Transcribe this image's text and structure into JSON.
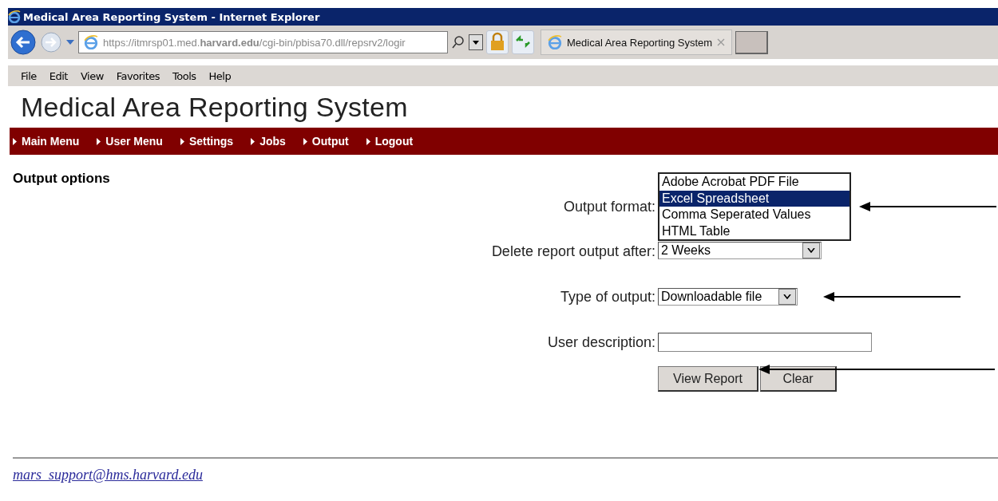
{
  "window": {
    "title": "Medical Area Reporting System - Internet Explorer"
  },
  "address_bar": {
    "url": "https://itmrsp01.med.**harvard.edu**/cgi-bin/pbisa70.dll/repsrv2/logir"
  },
  "tabs": [
    {
      "label": "Medical Area Reporting System",
      "selected": true
    }
  ],
  "menu": [
    "File",
    "Edit",
    "View",
    "Favorites",
    "Tools",
    "Help"
  ],
  "page_title": "Medical Area Reporting System",
  "nav": [
    "Main Menu",
    "User Menu",
    "Settings",
    "Jobs",
    "Output",
    "Logout"
  ],
  "section_title": "Output options",
  "fields": [
    {
      "kind": "listbox",
      "label": "Output format:",
      "options": [
        {
          "label": "Adobe Acrobat PDF File",
          "selected": false
        },
        {
          "label": "Excel Spreadsheet",
          "selected": true
        },
        {
          "label": "Comma Seperated Values",
          "selected": false
        },
        {
          "label": "HTML Table",
          "selected": false
        }
      ],
      "arrow": true
    },
    {
      "kind": "select",
      "label": "Delete report output after:",
      "value": "2 Weeks",
      "arrow": false
    },
    {
      "kind": "select",
      "label": "Type of output:",
      "value": "Downloadable file",
      "arrow": true
    },
    {
      "kind": "text",
      "label": "User description:",
      "arrow": false
    }
  ],
  "buttons": [
    "View Report",
    "Clear"
  ],
  "footer_link": "mars_support@hms.harvard.edu"
}
